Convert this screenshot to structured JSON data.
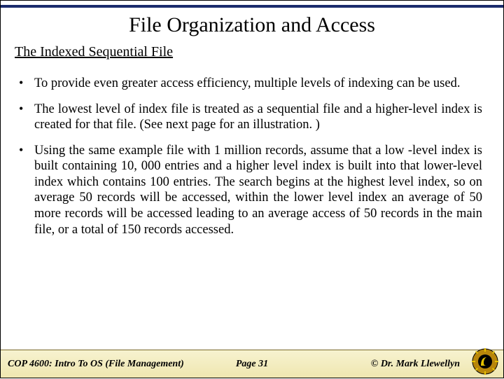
{
  "title": "File Organization and Access",
  "subtitle": "The Indexed Sequential File",
  "bullets": [
    "To provide even greater access efficiency, multiple levels of indexing can be used.",
    "The lowest level of index file is treated as a sequential file and a higher-level index is created for that file.  (See next page for an illustration. )",
    "Using the same example file with 1 million records, assume that a low -level index is built containing 10, 000 entries and a higher level index is built into that lower-level index which contains 100 entries.  The search begins at the highest level index, so on average 50 records will be accessed, within the lower level index an average of 50 more records will be accessed leading to an average access of 50 records in the main file, or a total of 150 records accessed."
  ],
  "footer": {
    "course": "COP 4600: Intro To OS  (File Management)",
    "page": "Page 31",
    "author": "© Dr. Mark Llewellyn"
  }
}
